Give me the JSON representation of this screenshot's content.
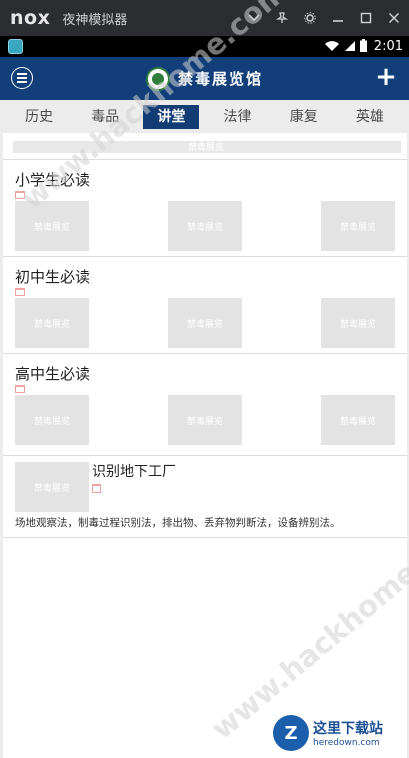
{
  "emulator": {
    "logo": "nox",
    "title": "夜神模拟器",
    "controls": [
      "chevron-down-icon",
      "pin-icon",
      "gear-icon",
      "minimize-icon",
      "maximize-icon",
      "close-icon"
    ]
  },
  "status_bar": {
    "time": "2:01"
  },
  "app": {
    "title": "禁毒展览馆",
    "colors": {
      "header": "#123f79",
      "active_tab": "#133c74",
      "emblem_green": "#2f7d3a"
    }
  },
  "tabs": [
    {
      "label": "历史",
      "active": false
    },
    {
      "label": "毒品",
      "active": false
    },
    {
      "label": "讲堂",
      "active": true
    },
    {
      "label": "法律",
      "active": false
    },
    {
      "label": "康复",
      "active": false
    },
    {
      "label": "英雄",
      "active": false
    }
  ],
  "banner": {
    "label": "禁毒展览"
  },
  "sections": [
    {
      "title": "小学生必读",
      "thumbs": [
        "禁毒展览",
        "禁毒展览",
        "禁毒展览"
      ]
    },
    {
      "title": "初中生必读",
      "thumbs": [
        "禁毒展览",
        "禁毒展览",
        "禁毒展览"
      ]
    },
    {
      "title": "高中生必读",
      "thumbs": [
        "禁毒展览",
        "禁毒展览",
        "禁毒展览"
      ]
    }
  ],
  "article": {
    "thumb": "禁毒展览",
    "title": "识别地下工厂",
    "description": "场地观察法，制毒过程识别法，排出物、丢弃物判断法，设备辨别法。"
  },
  "watermark": {
    "text": "www.hackhome.com"
  },
  "brand": {
    "name": "这里下载站",
    "url": "heredown.com",
    "mark": "Z"
  }
}
